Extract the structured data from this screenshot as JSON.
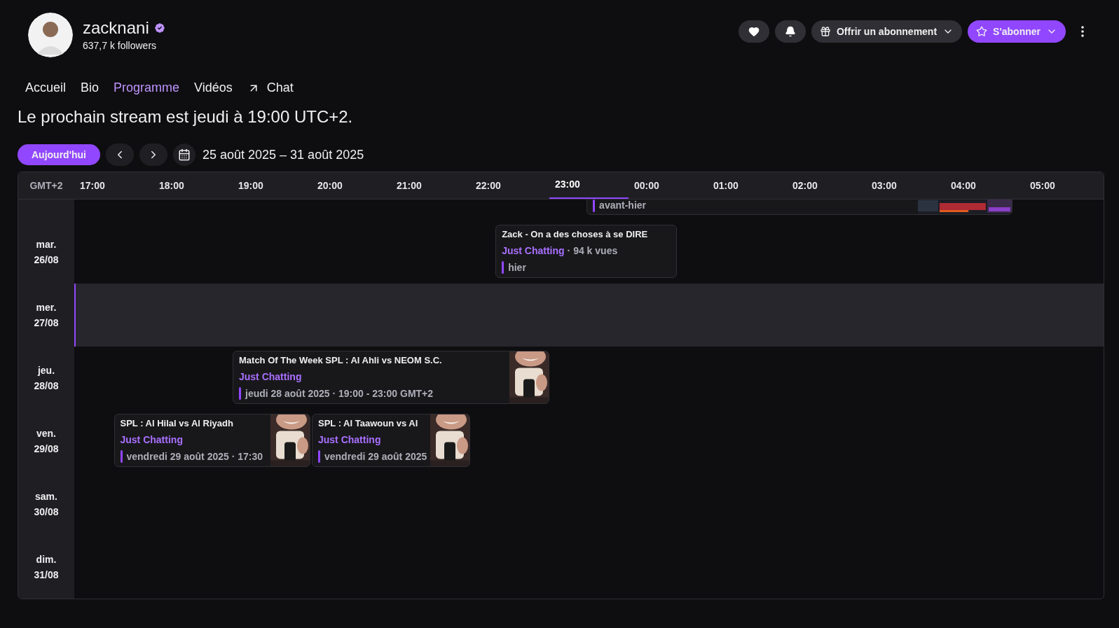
{
  "channel": {
    "name": "zacknani",
    "verified": true,
    "followers": "637,7 k followers"
  },
  "actions": {
    "gift_label": "Offrir un abonnement",
    "subscribe_label": "S'abonner"
  },
  "tabs": [
    {
      "label": "Accueil",
      "selected": false,
      "kind": "page"
    },
    {
      "label": "Bio",
      "selected": false,
      "kind": "page"
    },
    {
      "label": "Programme",
      "selected": true,
      "kind": "page"
    },
    {
      "label": "Vidéos",
      "selected": false,
      "kind": "page"
    },
    {
      "label": "Chat",
      "selected": false,
      "kind": "external"
    }
  ],
  "next_stream": "Le prochain stream est jeudi à 19:00 UTC+2.",
  "toolbar": {
    "today_label": "Aujourd'hui",
    "range": "25 août 2025 – 31 août 2025"
  },
  "schedule": {
    "timezone": "GMT+2",
    "hours": [
      {
        "label": "17:00",
        "selected": false
      },
      {
        "label": "18:00",
        "selected": false
      },
      {
        "label": "19:00",
        "selected": false
      },
      {
        "label": "20:00",
        "selected": false
      },
      {
        "label": "21:00",
        "selected": false
      },
      {
        "label": "22:00",
        "selected": false
      },
      {
        "label": "23:00",
        "selected": true
      },
      {
        "label": "00:00",
        "selected": false
      },
      {
        "label": "01:00",
        "selected": false
      },
      {
        "label": "02:00",
        "selected": false
      },
      {
        "label": "03:00",
        "selected": false
      },
      {
        "label": "04:00",
        "selected": false
      },
      {
        "label": "05:00",
        "selected": false
      }
    ],
    "days": [
      {
        "kind": "partial",
        "today": false,
        "events": [
          {
            "date_line": "avant-hier",
            "thumbnail": true
          }
        ]
      },
      {
        "kind": "day",
        "weekday": "mar.",
        "date": "26/08",
        "today": false,
        "events": [
          {
            "title": "Zack - On a des choses à se DIRE",
            "category": "Just Chatting",
            "views": "· 94 k vues",
            "date_line": "hier",
            "thumbnail": false
          }
        ]
      },
      {
        "kind": "day",
        "weekday": "mer.",
        "date": "27/08",
        "today": true
      },
      {
        "kind": "day",
        "weekday": "jeu.",
        "date": "28/08",
        "today": false,
        "events": [
          {
            "title": "Match Of The Week SPL : Al Ahli vs NEOM S.C.",
            "category": "Just Chatting",
            "date_line": "jeudi 28 août 2025 · 19:00 - 23:00 GMT+2",
            "thumbnail": true
          }
        ]
      },
      {
        "kind": "day",
        "weekday": "ven.",
        "date": "29/08",
        "today": false,
        "events": [
          {
            "title": "SPL : Al Hilal vs Al Riyadh",
            "category": "Just Chatting",
            "date_line": "vendredi 29 août 2025 · 17:30",
            "thumbnail": true
          },
          {
            "title": "SPL : Al Taawoun vs Al",
            "category": "Just Chatting",
            "date_line": "vendredi 29 août 2025",
            "thumbnail": true
          }
        ]
      },
      {
        "kind": "day",
        "weekday": "sam.",
        "date": "30/08",
        "today": false
      },
      {
        "kind": "day",
        "weekday": "dim.",
        "date": "31/08",
        "today": false
      }
    ]
  }
}
